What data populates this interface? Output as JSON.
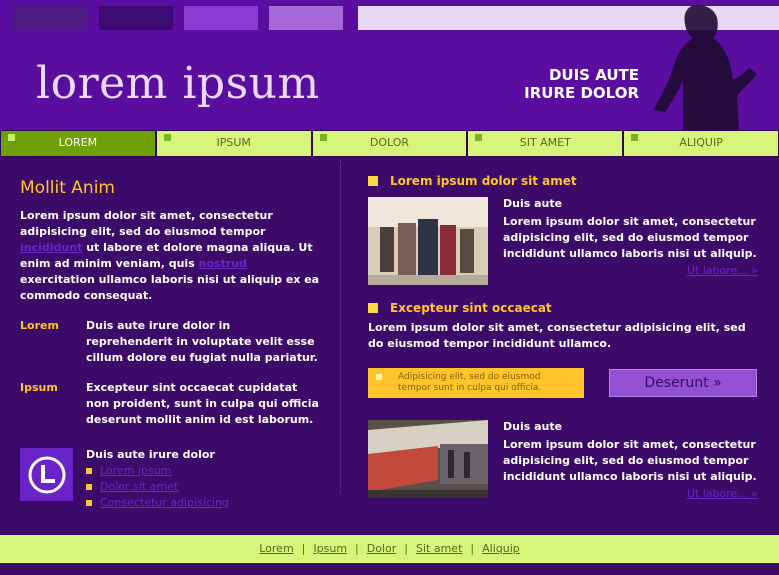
{
  "header": {
    "logo": "lorem ipsum",
    "tagline_line1": "DUIS AUTE",
    "tagline_line2": "IRURE DOLOR"
  },
  "nav": {
    "items": [
      {
        "label": "LOREM",
        "active": true
      },
      {
        "label": "IPSUM"
      },
      {
        "label": "DOLOR"
      },
      {
        "label": "SIT AMET"
      },
      {
        "label": "ALIQUIP"
      }
    ]
  },
  "left": {
    "title": "Mollit Anim",
    "paragraph_part1": "Lorem ipsum dolor sit amet, consectetur adipisicing elit, sed do eiusmod tempor",
    "paragraph_link1": "incididunt",
    "paragraph_part2": "ut labore et dolore magna aliqua. Ut enim ad minim veniam, quis",
    "paragraph_link2": "nostrud",
    "paragraph_part3": "exercitation ullamco laboris nisi ut aliquip ex ea commodo consequat.",
    "defs": [
      {
        "term": "Lorem",
        "desc": "Duis aute irure dolor in reprehenderit in voluptate velit esse cillum dolore eu fugiat nulla pariatur."
      },
      {
        "term": "Ipsum",
        "desc": "Excepteur sint occaecat cupidatat non proident, sunt in culpa qui officia deserunt mollit anim id est laborum."
      }
    ],
    "links_title": "Duis aute irure dolor",
    "links": [
      "Lorem ipsum",
      "Dolor sit amet",
      "Consectetur adipisicing"
    ]
  },
  "right": {
    "section1_title": "Lorem ipsum dolor sit amet",
    "item1": {
      "title": "Duis aute",
      "text": "Lorem ipsum dolor sit amet, consectetur adipisicing elit, sed do eiusmod tempor incididunt ullamco laboris nisi ut aliquip.",
      "more": "Ut labore... »"
    },
    "section2_title": "Excepteur sint occaecat",
    "section2_text": "Lorem ipsum dolor sit amet, consectetur adipisicing elit, sed do eiusmod tempor incididunt ullamco.",
    "note": "Adipisicing elit, sed do eiusmod tempor sunt in culpa qui officia.",
    "button": "Deserunt »",
    "item2": {
      "title": "Duis aute",
      "text": "Lorem ipsum dolor sit amet, consectetur adipisicing elit, sed do eiusmod tempor incididunt ullamco laboris nisi ut aliquip.",
      "more": "Ut labore... »"
    }
  },
  "footer": {
    "links": [
      "Lorem",
      "Ipsum",
      "Dolor",
      "Sit amet",
      "Aliquip"
    ],
    "separator": "|"
  },
  "colors": {
    "background": "#3c0a69",
    "header": "#5a0e9f",
    "accent_yellow": "#ffc52a",
    "nav_green": "#d7f57a",
    "nav_active": "#6fa005"
  }
}
